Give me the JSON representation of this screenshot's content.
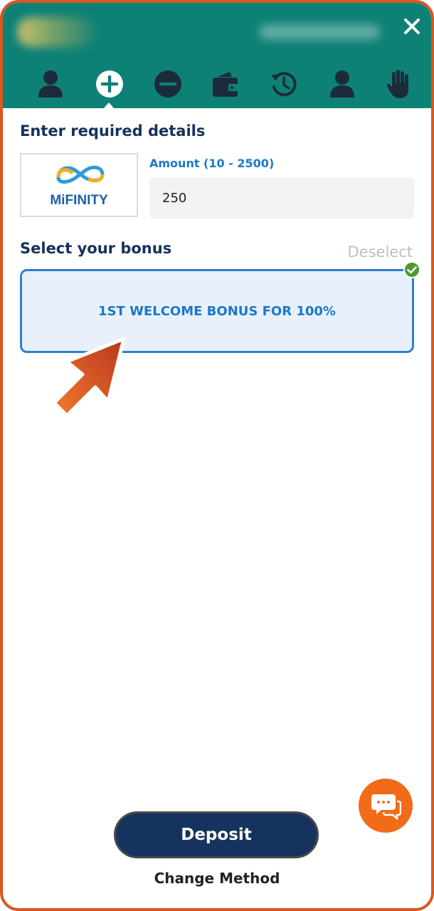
{
  "header": {
    "close_icon": "close-icon",
    "tabs": [
      {
        "icon": "user-icon",
        "active": false
      },
      {
        "icon": "plus-circle-icon",
        "active": true
      },
      {
        "icon": "minus-circle-icon",
        "active": false
      },
      {
        "icon": "wallet-icon",
        "active": false
      },
      {
        "icon": "history-icon",
        "active": false
      },
      {
        "icon": "user-icon",
        "active": false
      },
      {
        "icon": "hand-icon",
        "active": false
      }
    ]
  },
  "details": {
    "title": "Enter required details",
    "method_logo_text": "MiFINITY",
    "amount_label": "Amount (10 - 2500)",
    "amount_value": "250"
  },
  "bonus": {
    "title": "Select your bonus",
    "deselect_label": "Deselect",
    "selected_label": "1ST WELCOME BONUS FOR 100%"
  },
  "actions": {
    "deposit_label": "Deposit",
    "change_method_label": "Change Method"
  },
  "colors": {
    "header_bg": "#0e8176",
    "accent_blue": "#1b78c8",
    "navy": "#15335e",
    "orange": "#f26b18",
    "check_green": "#4a9a2e"
  }
}
